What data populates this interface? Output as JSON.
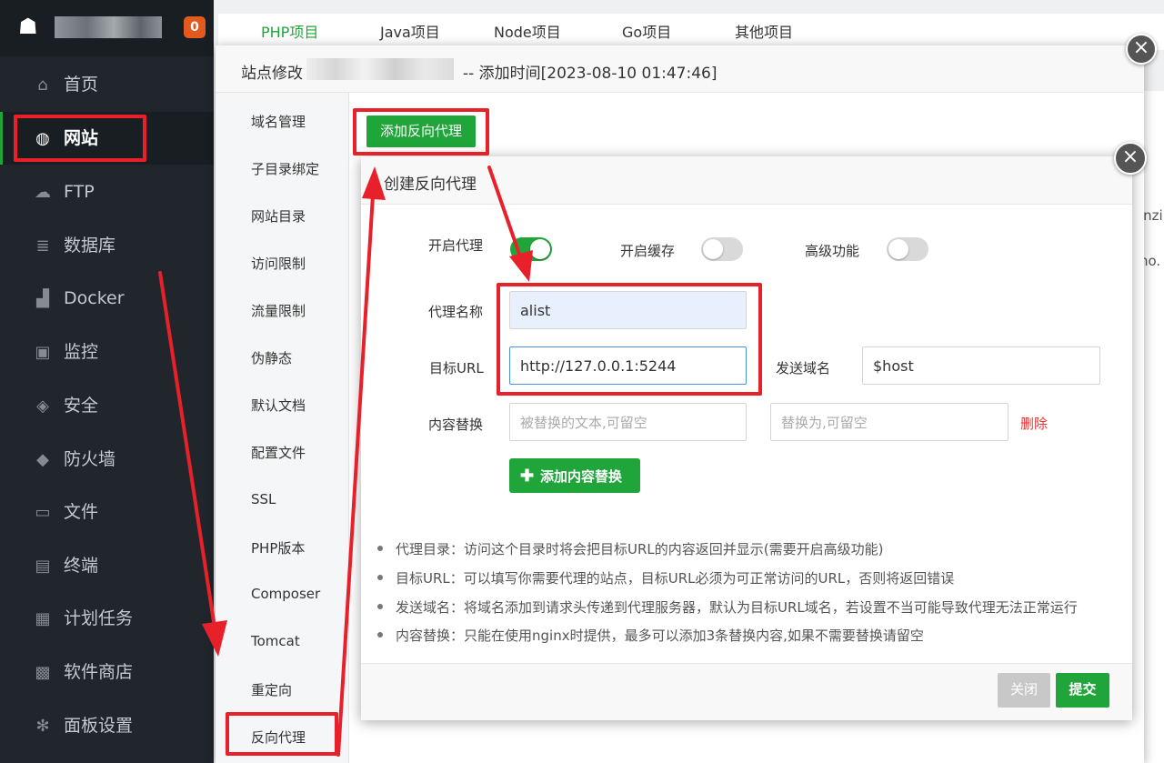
{
  "sidebar": {
    "badge": "0",
    "items": [
      {
        "label": "首页",
        "icon": "home-icon",
        "glyph": "⌂"
      },
      {
        "label": "网站",
        "icon": "globe-icon",
        "glyph": "◍"
      },
      {
        "label": "FTP",
        "icon": "ftp-icon",
        "glyph": "☁"
      },
      {
        "label": "数据库",
        "icon": "database-icon",
        "glyph": "≣"
      },
      {
        "label": "Docker",
        "icon": "docker-icon",
        "glyph": "▟"
      },
      {
        "label": "监控",
        "icon": "monitor-icon",
        "glyph": "▣"
      },
      {
        "label": "安全",
        "icon": "shield-icon",
        "glyph": "◈"
      },
      {
        "label": "防火墙",
        "icon": "firewall-icon",
        "glyph": "◆"
      },
      {
        "label": "文件",
        "icon": "folder-icon",
        "glyph": "▭"
      },
      {
        "label": "终端",
        "icon": "terminal-icon",
        "glyph": "▤"
      },
      {
        "label": "计划任务",
        "icon": "calendar-icon",
        "glyph": "▦"
      },
      {
        "label": "软件商店",
        "icon": "apps-icon",
        "glyph": "▩"
      },
      {
        "label": "面板设置",
        "icon": "gear-icon",
        "glyph": "✻"
      }
    ]
  },
  "bg_tabs": [
    "PHP项目",
    "Java项目",
    "Node项目",
    "Go项目",
    "其他项目"
  ],
  "bg_edge": [
    "inzi",
    "no."
  ],
  "site_dialog": {
    "title_prefix": "站点修改",
    "title_suffix": "-- 添加时间[2023-08-10 01:47:46]",
    "nav": [
      "域名管理",
      "子目录绑定",
      "网站目录",
      "访问限制",
      "流量限制",
      "伪静态",
      "默认文档",
      "配置文件",
      "SSL",
      "PHP版本",
      "Composer",
      "Tomcat",
      "重定向",
      "反向代理"
    ],
    "add_proxy_label": "添加反向代理"
  },
  "proxy_dialog": {
    "title": "创建反向代理",
    "enable_proxy_label": "开启代理",
    "enable_cache_label": "开启缓存",
    "advanced_label": "高级功能",
    "toggles": {
      "proxy": true,
      "cache": false,
      "advanced": false
    },
    "name_label": "代理名称",
    "name_value": "alist",
    "target_label": "目标URL",
    "target_value": "http://127.0.0.1:5244",
    "send_domain_label": "发送域名",
    "send_domain_value": "$host",
    "replace_label": "内容替换",
    "replace_from_placeholder": "被替换的文本,可留空",
    "replace_to_placeholder": "替换为,可留空",
    "delete_label": "删除",
    "add_replace_label": "添加内容替换",
    "tips": [
      "代理目录：访问这个目录时将会把目标URL的内容返回并显示(需要开启高级功能)",
      "目标URL：可以填写你需要代理的站点，目标URL必须为可正常访问的URL，否则将返回错误",
      "发送域名：将域名添加到请求头传递到代理服务器，默认为目标URL域名，若设置不当可能导致代理无法正常运行",
      "内容替换：只能在使用nginx时提供，最多可以添加3条替换内容,如果不需要替换请留空"
    ],
    "close_label": "关闭",
    "submit_label": "提交"
  },
  "colors": {
    "accent": "#20a53a",
    "annotation": "#e8202a",
    "sidebar_bg": "#20262c"
  }
}
